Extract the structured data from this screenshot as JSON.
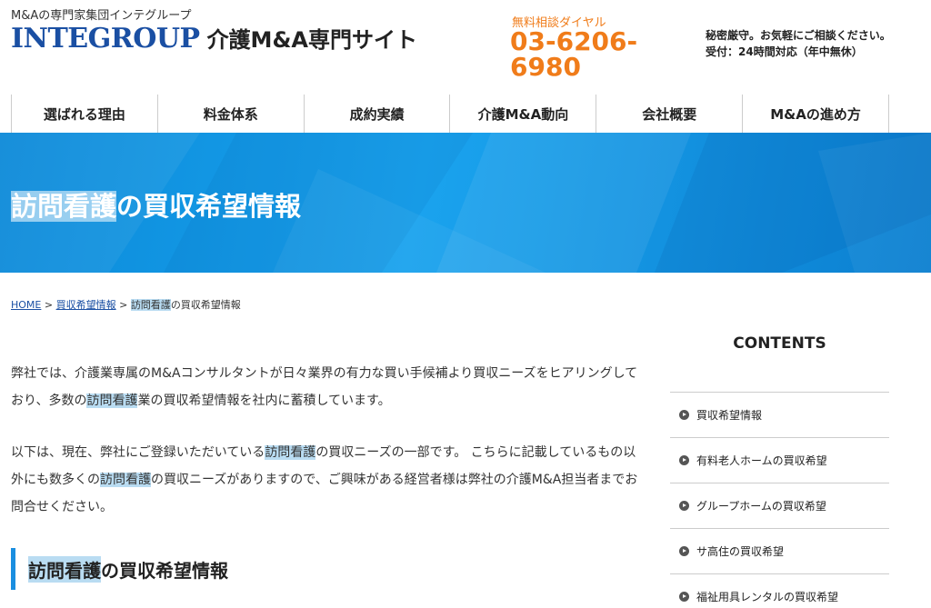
{
  "header": {
    "tagline": "M&Aの専門家集団インテグループ",
    "logo_main": "INTEGROUP",
    "logo_sub": "介護M&A専門サイト",
    "phone_label": "無料相談ダイヤル",
    "phone_number": "03-6206-6980",
    "notice1": "秘密厳守。お気軽にご相談ください。",
    "notice2": "受付：24時間対応（年中無休）"
  },
  "nav": {
    "items": [
      "選ばれる理由",
      "料金体系",
      "成約実績",
      "介護M&A動向",
      "会社概要",
      "M&Aの進め方"
    ]
  },
  "hero": {
    "title_highlight": "訪問看護",
    "title_rest": "の買収希望情報"
  },
  "breadcrumb": {
    "home": "HOME",
    "sep": ">",
    "parent": "買収希望情報",
    "current_highlight": "訪問看護",
    "current_rest": "の買収希望情報"
  },
  "main": {
    "para1_a": "弊社では、介護業専属のM&Aコンサルタントが日々業界の有力な買い手候補より買収ニーズをヒアリングしており、多数の",
    "para1_hl": "訪問看護",
    "para1_b": "業の買収希望情報を社内に蓄積しています。",
    "para2_a": "以下は、現在、弊社にご登録いただいている",
    "para2_hl1": "訪問看護",
    "para2_b": "の買収ニーズの一部です。 こちらに記載しているもの以外にも数多くの",
    "para2_hl2": "訪問看護",
    "para2_c": "の買収ニーズがありますので、ご興味がある経営者様は弊社の介護M&A担当者までお問合せください。",
    "section_highlight": "訪問看護",
    "section_rest": "の買収希望情報"
  },
  "sidebar": {
    "title": "CONTENTS",
    "items": [
      "買収希望情報",
      "有料老人ホームの買収希望",
      "グループホームの買収希望",
      "サ高住の買収希望",
      "福祉用具レンタルの買収希望"
    ]
  },
  "colors": {
    "brand_blue": "#1a4fa3",
    "phone_orange": "#f07c1a",
    "hero_blue": "#1aa3ee",
    "highlight": "#b9dcf2"
  }
}
